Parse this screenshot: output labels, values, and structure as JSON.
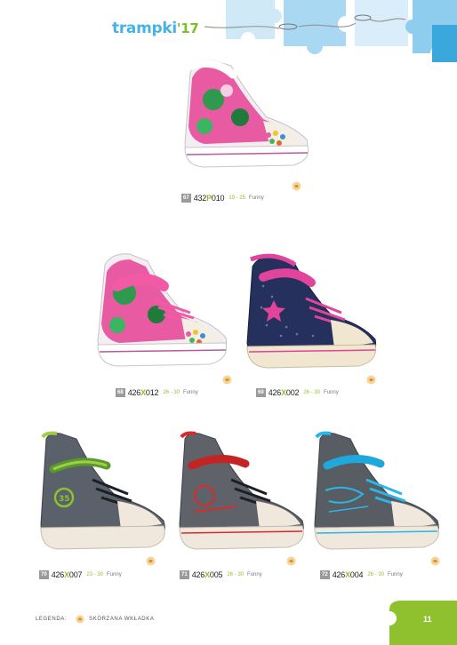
{
  "header": {
    "brand": "trampki",
    "year": "'17"
  },
  "colors": {
    "brand_blue": "#46b3e6",
    "accent_green": "#8fc12f",
    "puzzle_blue": "#a9d8f2"
  },
  "products": [
    {
      "page": "67",
      "code_prefix": "432",
      "code_letter": "P",
      "code_suffix": "010",
      "sizes": "19 - 25",
      "tag": "Funny"
    },
    {
      "page": "68",
      "code_prefix": "426",
      "code_letter": "X",
      "code_suffix": "012",
      "sizes": "26 - 30",
      "tag": "Funny"
    },
    {
      "page": "69",
      "code_prefix": "426",
      "code_letter": "X",
      "code_suffix": "002",
      "sizes": "26 - 30",
      "tag": "Funny"
    },
    {
      "page": "70",
      "code_prefix": "426",
      "code_letter": "X",
      "code_suffix": "007",
      "sizes": "23 - 30",
      "tag": "Funny"
    },
    {
      "page": "71",
      "code_prefix": "426",
      "code_letter": "X",
      "code_suffix": "005",
      "sizes": "26 - 30",
      "tag": "Funny"
    },
    {
      "page": "72",
      "code_prefix": "426",
      "code_letter": "X",
      "code_suffix": "004",
      "sizes": "26 - 30",
      "tag": "Funny"
    }
  ],
  "footer": {
    "legend_label": "LEGENDA:",
    "legend_item": "SKÓRZANA WKŁADKA",
    "page_number": "11"
  }
}
